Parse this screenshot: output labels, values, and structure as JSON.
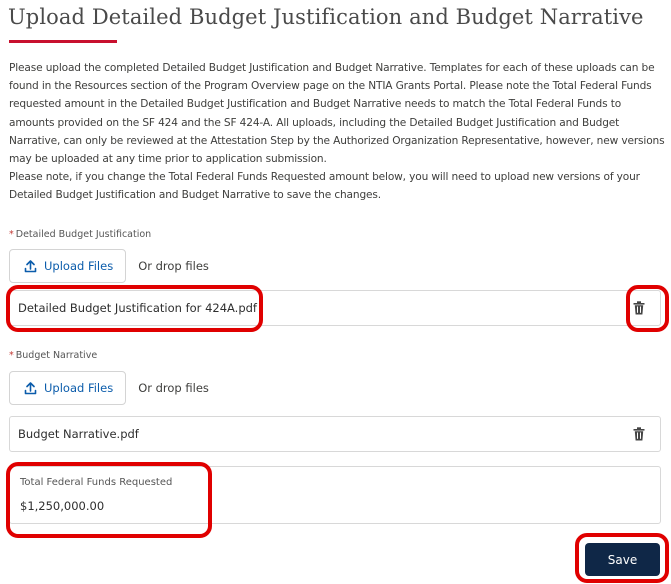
{
  "page": {
    "title": "Upload Detailed Budget Justification and Budget Narrative"
  },
  "intro": {
    "paragraph1": "Please upload the completed Detailed Budget Justification and Budget Narrative.  Templates for each of these uploads can be found in the Resources section of the Program Overview page on the NTIA Grants Portal.  Please note the Total Federal Funds requested amount in the Detailed Budget Justification and Budget Narrative needs to match the Total Federal Funds to amounts provided on the SF 424 and the SF 424-A.  All uploads, including the Detailed Budget Justification and Budget Narrative, can only be reviewed at the Attestation Step by the Authorized Organization Representative, however, new versions may be uploaded at any time prior to application submission.",
    "paragraph2": "Please note, if you change the Total Federal Funds Requested amount below, you will need to upload new versions of your Detailed Budget Justification and Budget Narrative to save the changes."
  },
  "justification": {
    "required_mark": "*",
    "label": "Detailed Budget Justification",
    "upload_label": "Upload Files",
    "drop_text": "Or drop files",
    "file_name": "Detailed Budget Justification for 424A.pdf"
  },
  "narrative": {
    "required_mark": "*",
    "label": "Budget Narrative",
    "upload_label": "Upload Files",
    "drop_text": "Or drop files",
    "file_name": "Budget Narrative.pdf"
  },
  "funds": {
    "label": "Total Federal Funds Requested",
    "value": "$1,250,000.00"
  },
  "actions": {
    "save_label": "Save"
  },
  "colors": {
    "accent_rule": "#c8102e",
    "link": "#0b5cab",
    "save_bg": "#0f2747",
    "annotation": "#e00000"
  },
  "icons": {
    "upload": "upload-icon",
    "delete": "trash-icon"
  }
}
